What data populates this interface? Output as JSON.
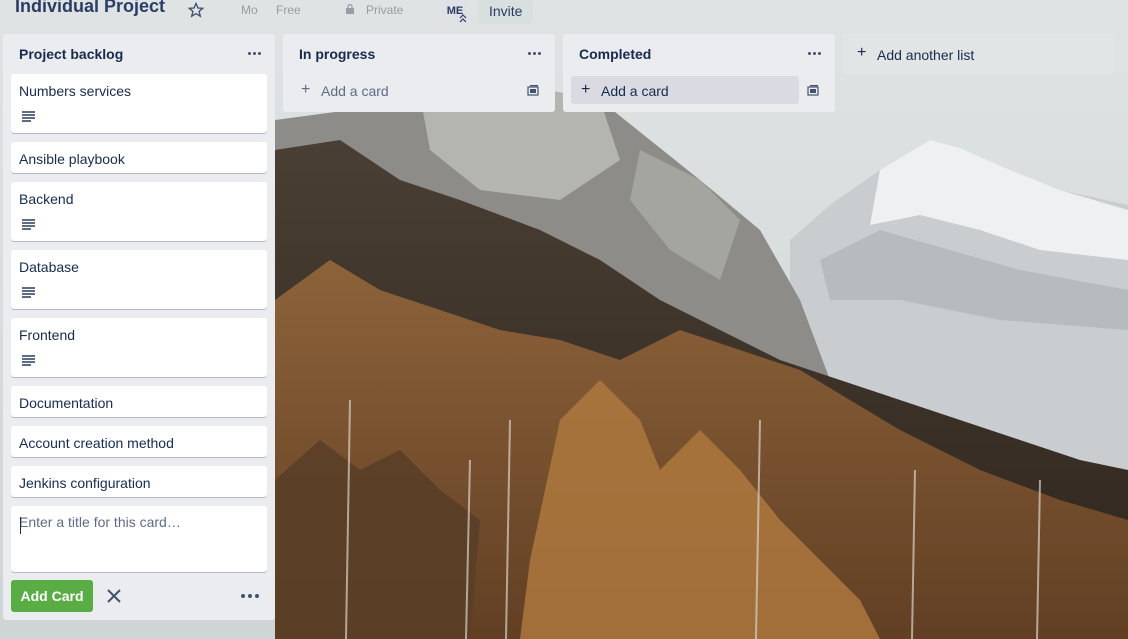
{
  "header": {
    "board_title": "Individual Project",
    "team_label": "Mo",
    "plan_label": "Free",
    "visibility_label": "Private",
    "member_initials": "ME",
    "invite_label": "Invite"
  },
  "lists": [
    {
      "title": "Project backlog",
      "cards": [
        {
          "title": "Numbers services",
          "has_description": true
        },
        {
          "title": "Ansible playbook",
          "has_description": false
        },
        {
          "title": "Backend",
          "has_description": true
        },
        {
          "title": "Database",
          "has_description": true
        },
        {
          "title": "Frontend",
          "has_description": true
        },
        {
          "title": "Documentation",
          "has_description": false
        },
        {
          "title": "Account creation method",
          "has_description": false
        },
        {
          "title": "Jenkins configuration",
          "has_description": false
        }
      ],
      "composer": {
        "placeholder": "Enter a title for this card…",
        "submit_label": "Add Card"
      }
    },
    {
      "title": "In progress",
      "add_card_label": "Add a card"
    },
    {
      "title": "Completed",
      "add_card_label": "Add a card"
    }
  ],
  "add_list_label": "Add another list",
  "colors": {
    "list_bg": "#ebecf0",
    "card_bg": "#ffffff",
    "text_primary": "#172b4d",
    "text_muted": "#5e6c84",
    "add_button_green": "#5aac44",
    "header_title": "#2b3c66"
  },
  "icons": [
    "star-icon",
    "lock-icon",
    "admin-chevron-icon",
    "list-menu-icon",
    "description-icon",
    "plus-icon",
    "card-template-icon",
    "close-icon",
    "more-options-icon"
  ]
}
